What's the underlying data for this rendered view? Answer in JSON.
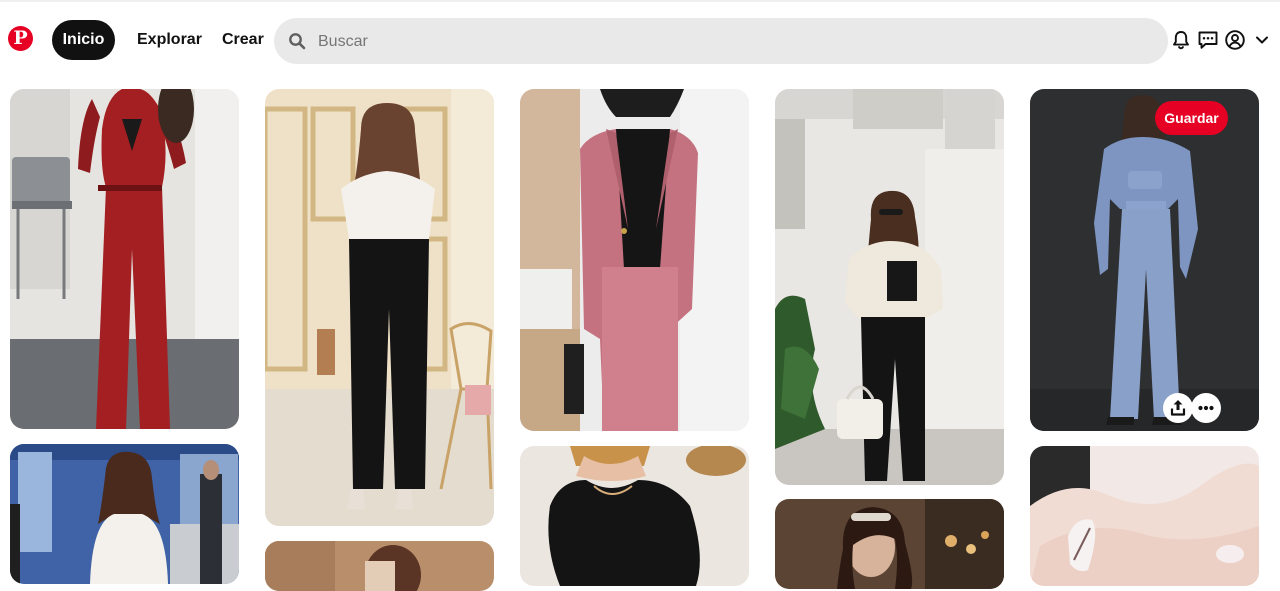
{
  "header": {
    "logo_letter": "P",
    "nav": {
      "home": "Inicio",
      "explore": "Explorar",
      "create": "Crear"
    },
    "search": {
      "placeholder": "Buscar"
    },
    "icons": [
      "notifications-bell-icon",
      "messages-icon",
      "profile-icon",
      "chevron-down-icon"
    ]
  },
  "hover_pin": {
    "save_label": "Guardar"
  },
  "colors": {
    "brand_red": "#e60023",
    "active_nav_bg": "#111111",
    "search_bg": "#e9e9e9"
  },
  "pins": [
    {
      "column": 1,
      "description": "red pantsuit"
    },
    {
      "column": 1,
      "description": "white blazer street photo"
    },
    {
      "column": 2,
      "description": "white blouse and black trousers"
    },
    {
      "column": 2,
      "description": "tan outfit"
    },
    {
      "column": 3,
      "description": "pink suit"
    },
    {
      "column": 3,
      "description": "black crop top"
    },
    {
      "column": 4,
      "description": "cream cropped blazer"
    },
    {
      "column": 4,
      "description": "portrait"
    },
    {
      "column": 5,
      "description": "blue suit"
    },
    {
      "column": 5,
      "description": "manicured nails"
    }
  ]
}
